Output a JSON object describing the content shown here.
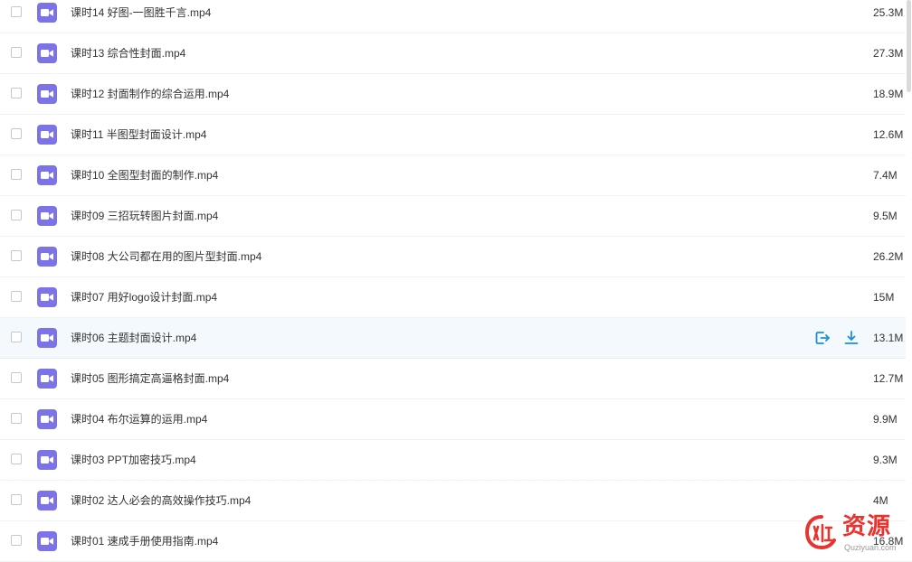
{
  "files": [
    {
      "name": "课时14 好图-一图胜千言.mp4",
      "size": "25.3M"
    },
    {
      "name": "课时13 综合性封面.mp4",
      "size": "27.3M"
    },
    {
      "name": "课时12 封面制作的综合运用.mp4",
      "size": "18.9M"
    },
    {
      "name": "课时11 半图型封面设计.mp4",
      "size": "12.6M"
    },
    {
      "name": "课时10 全图型封面的制作.mp4",
      "size": "7.4M"
    },
    {
      "name": "课时09 三招玩转图片封面.mp4",
      "size": "9.5M"
    },
    {
      "name": "课时08 大公司都在用的图片型封面.mp4",
      "size": "26.2M"
    },
    {
      "name": "课时07 用好logo设计封面.mp4",
      "size": "15M"
    },
    {
      "name": "课时06 主题封面设计.mp4",
      "size": "13.1M",
      "hovered": true
    },
    {
      "name": "课时05 图形搞定高逼格封面.mp4",
      "size": "12.7M"
    },
    {
      "name": "课时04 布尔运算的运用.mp4",
      "size": "9.9M"
    },
    {
      "name": "课时03 PPT加密技巧.mp4",
      "size": "9.3M"
    },
    {
      "name": "课时02 达人必会的高效操作技巧.mp4",
      "size": "4M"
    },
    {
      "name": "课时01 速成手册使用指南.mp4",
      "size": "16.8M"
    }
  ],
  "icons": {
    "file": "video-file-icon",
    "share": "share-icon",
    "download": "download-icon"
  },
  "colors": {
    "file_icon": "#7d73e8",
    "action": "#1a8fe0",
    "hover_row": "#f4f9fd",
    "watermark": "#e8342f"
  },
  "watermark": {
    "title": "资源",
    "subtitle": "Quziyuan.com"
  }
}
